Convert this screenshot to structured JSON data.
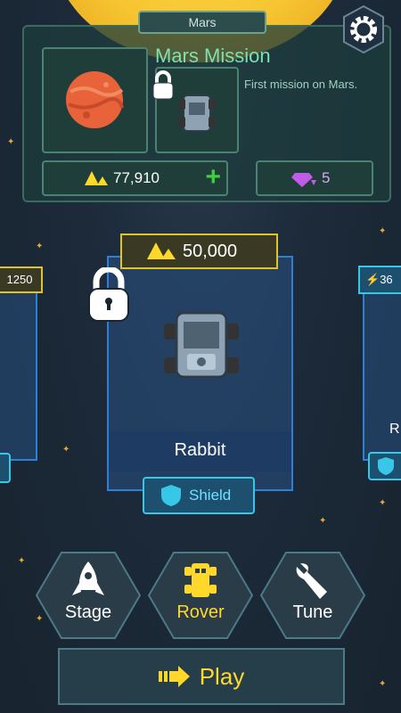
{
  "header": {
    "planet_tab": "Mars"
  },
  "mission": {
    "title": "Mars Mission",
    "description": "First mission on Mars."
  },
  "resources": {
    "gold": "77,910",
    "gems": "5"
  },
  "carousel": {
    "left_price": "1250",
    "main": {
      "price": "50,000",
      "name": "Rabbit",
      "ability": "Shield",
      "locked": true
    },
    "right_energy": "36",
    "right_name_partial": "R"
  },
  "nav": {
    "stage": "Stage",
    "rover": "Rover",
    "tune": "Tune",
    "play": "Play"
  },
  "colors": {
    "gold": "#ffd82a",
    "accent_green": "#7ee0b0",
    "card_blue": "#2d7fd8",
    "shield_cyan": "#38c7e8"
  }
}
